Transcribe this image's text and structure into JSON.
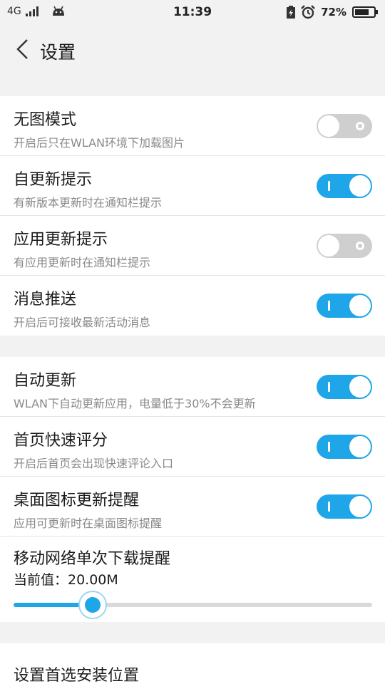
{
  "status_bar": {
    "network": "4G",
    "time": "11:39",
    "battery": "72%"
  },
  "app_bar": {
    "title": "设置"
  },
  "group1": [
    {
      "label": "无图模式",
      "sub": "开启后只在WLAN环境下加载图片",
      "on": false
    },
    {
      "label": "自更新提示",
      "sub": "有新版本更新时在通知栏提示",
      "on": true
    },
    {
      "label": "应用更新提示",
      "sub": "有应用更新时在通知栏提示",
      "on": false
    },
    {
      "label": "消息推送",
      "sub": "开启后可接收最新活动消息",
      "on": true
    }
  ],
  "group2": [
    {
      "label": "自动更新",
      "sub": "WLAN下自动更新应用，电量低于30%不会更新",
      "on": true
    },
    {
      "label": "首页快速评分",
      "sub": "开启后首页会出现快速评论入口",
      "on": true
    },
    {
      "label": "桌面图标更新提醒",
      "sub": "应用可更新时在桌面图标提醒",
      "on": true
    }
  ],
  "download_limit": {
    "label": "移动网络单次下载提醒",
    "value_text": "当前值：20.00M",
    "level": 0.22
  },
  "group3": {
    "install_location_label": "设置首选安装位置"
  },
  "colors": {
    "accent": "#1ea6e8",
    "toggle_off": "#cfcfcf",
    "background": "#f2f2f2"
  }
}
